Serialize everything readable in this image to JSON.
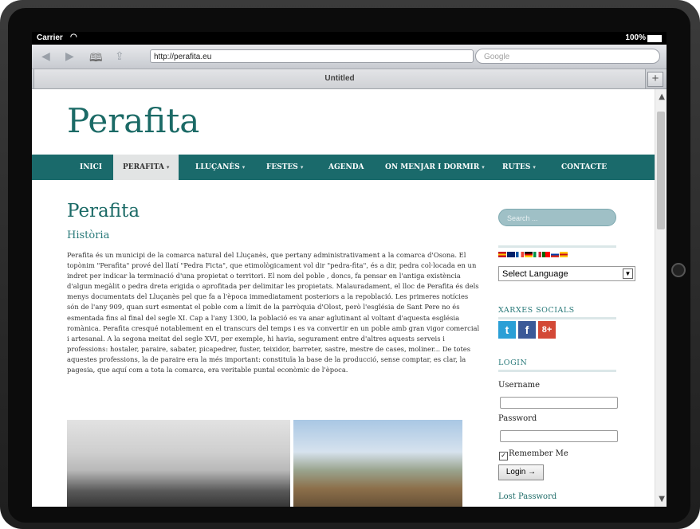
{
  "status": {
    "carrier": "Carrier",
    "battery": "100%"
  },
  "browser": {
    "url": "http://perafita.eu",
    "search_placeholder": "Google",
    "tab_title": "Untitled",
    "add_tab": "+"
  },
  "site": {
    "title": "Perafita",
    "nav": [
      {
        "label": "INICI"
      },
      {
        "label": "PERAFITA",
        "caret": "▾"
      },
      {
        "label": "LLUÇANÈS",
        "caret": "▾"
      },
      {
        "label": "FESTES",
        "caret": "▾"
      },
      {
        "label": "AGENDA"
      },
      {
        "label": "ON MENJAR I DORMIR",
        "caret": "▾"
      },
      {
        "label": "RUTES",
        "caret": "▾"
      },
      {
        "label": "CONTACTE"
      }
    ]
  },
  "content": {
    "page_title": "Perafita",
    "section_title": "Història",
    "body": "Perafita és un municipi de la comarca natural del Lluçanès, que pertany administrativament a la comarca d'Osona. El topònim \"Perafita\" prové del llatí \"Pedra Ficta\", que etimològicament vol dir \"pedra-fita\", és a dir, pedra col·locada en un indret per indicar la terminació d'una propietat o territori. El nom del poble , doncs, fa pensar en l'antiga existència d'algun megàlit o pedra dreta erigida o aprofitada per delimitar les propietats. Malauradament, el lloc de Perafita és dels menys documentats del Lluçanès pel que fa a l'època immediatament posteriors a la repoblació. Les primeres notícies són de l'any 909, quan surt esmentat el poble com a límit de la parròquia d'Olost, però l'església de Sant Pere no és esmentada fins al final del segle XI. Cap a l'any 1300, la població es va anar aglutinant al voltant d'aquesta església romànica. Perafita cresqué notablement en el transcurs del temps i es va convertir en un poble amb gran vigor comercial i artesanal. A la segona meitat del segle XVI, per exemple, hi havia, segurament entre d'altres aquests serveis i professions: hostaler, paraire, sabater, picapedrer, fuster, teixidor, barreter, sastre, mestre de cases, moliner... De totes aquestes professions, la de paraire era la més important: constituïa la base de la producció, sense comptar, es clar, la pagesia, que aquí com a tota la comarca, era veritable puntal econòmic de l'època."
  },
  "sidebar": {
    "search_placeholder": "Search ...",
    "language_select": "Select Language",
    "social_title": "XARXES SOCIALS",
    "social": [
      {
        "name": "twitter-icon",
        "glyph": "t",
        "color": "#2a9fd6"
      },
      {
        "name": "facebook-icon",
        "glyph": "f",
        "color": "#3b5998"
      },
      {
        "name": "google-plus-icon",
        "glyph": "8+",
        "color": "#d34836"
      }
    ],
    "login_title": "LOGIN",
    "username_label": "Username",
    "password_label": "Password",
    "remember_label": "Remember Me",
    "login_button": "Login →",
    "lost_password": "Lost Password"
  }
}
